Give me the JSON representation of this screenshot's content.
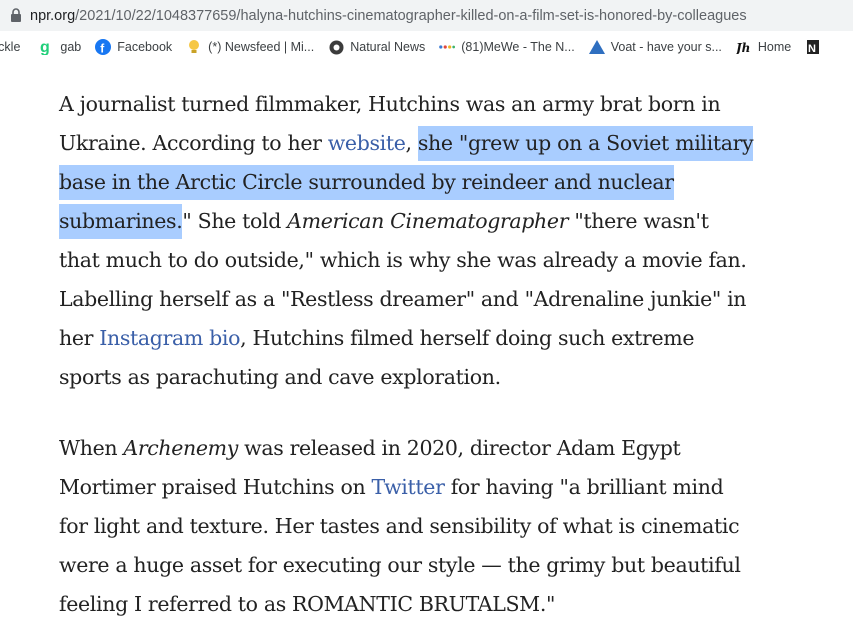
{
  "browser": {
    "url_domain": "npr.org",
    "url_path": "/2021/10/22/1048377659/halyna-hutchins-cinematographer-killed-on-a-film-set-is-honored-by-colleagues",
    "bookmarks": [
      {
        "label": "rckle",
        "icon": "partial-favicon"
      },
      {
        "label": "gab",
        "icon": "gab-g-icon"
      },
      {
        "label": "Facebook",
        "icon": "facebook-icon"
      },
      {
        "label": "(*) Newsfeed | Mi...",
        "icon": "lightbulb-icon"
      },
      {
        "label": "Natural News",
        "icon": "natural-news-icon"
      },
      {
        "label": "(81)MeWe - The N...",
        "icon": "mewe-dots-icon"
      },
      {
        "label": "Voat - have your s...",
        "icon": "voat-triangle-icon"
      },
      {
        "label": "Home",
        "icon": "jh-icon"
      }
    ]
  },
  "article": {
    "p1": {
      "l1": "A journalist turned filmmaker, Hutchins was an army brat born in",
      "l2_a": "Ukraine. According to her ",
      "l2_link": "website",
      "l2_b": ", ",
      "l2_hl": "she \"grew up on a Soviet military",
      "l3_hl": "base in the Arctic Circle surrounded by reindeer and nuclear",
      "l4_hl": "submarines.",
      "l4_a": "\" She told ",
      "l4_em": "American Cinematographer",
      "l4_b": " \"there wasn't",
      "l5": "that much to do outside,\" which is why she was already a movie fan.",
      "l6": "Labelling herself as a \"Restless dreamer\" and \"Adrenaline junkie\" in",
      "l7_a": "her ",
      "l7_link": "Instagram bio",
      "l7_b": ", Hutchins filmed herself doing such extreme",
      "l8": "sports as parachuting and cave exploration."
    },
    "p2": {
      "l1_a": "When ",
      "l1_em": "Archenemy",
      "l1_b": " was released in 2020, director Adam Egypt",
      "l2_a": "Mortimer praised Hutchins on ",
      "l2_link": "Twitter",
      "l2_b": " for having \"a brilliant mind",
      "l3": "for light and texture. Her tastes and sensibility of what is cinematic",
      "l4": "were a huge asset for executing our style — the grimy but beautiful",
      "l5": "feeling I referred to as ROMANTIC BRUTALSM.\""
    }
  },
  "colors": {
    "link": "#3a5fa8",
    "highlight": "#a9cdff",
    "text": "#222222"
  }
}
